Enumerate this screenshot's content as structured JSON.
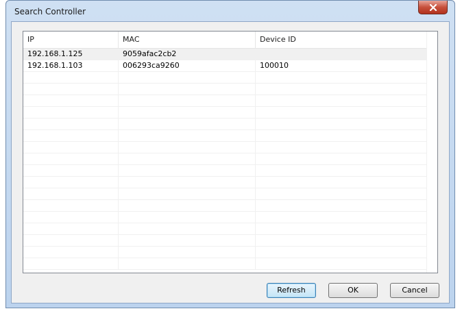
{
  "window": {
    "title": "Search Controller"
  },
  "list": {
    "columns": [
      "IP",
      "MAC",
      "Device ID"
    ],
    "rows": [
      {
        "ip": "192.168.1.125",
        "mac": "9059afac2cb2",
        "device_id": ""
      },
      {
        "ip": "192.168.1.103",
        "mac": "006293ca9260",
        "device_id": "100010"
      }
    ]
  },
  "buttons": {
    "refresh": "Refresh",
    "ok": "OK",
    "cancel": "Cancel"
  },
  "colors": {
    "close_button": "#c7503c",
    "selected_row": "#f0f0f0",
    "default_button_border": "#3c7fb1"
  },
  "icons": {
    "close": "close-icon"
  }
}
